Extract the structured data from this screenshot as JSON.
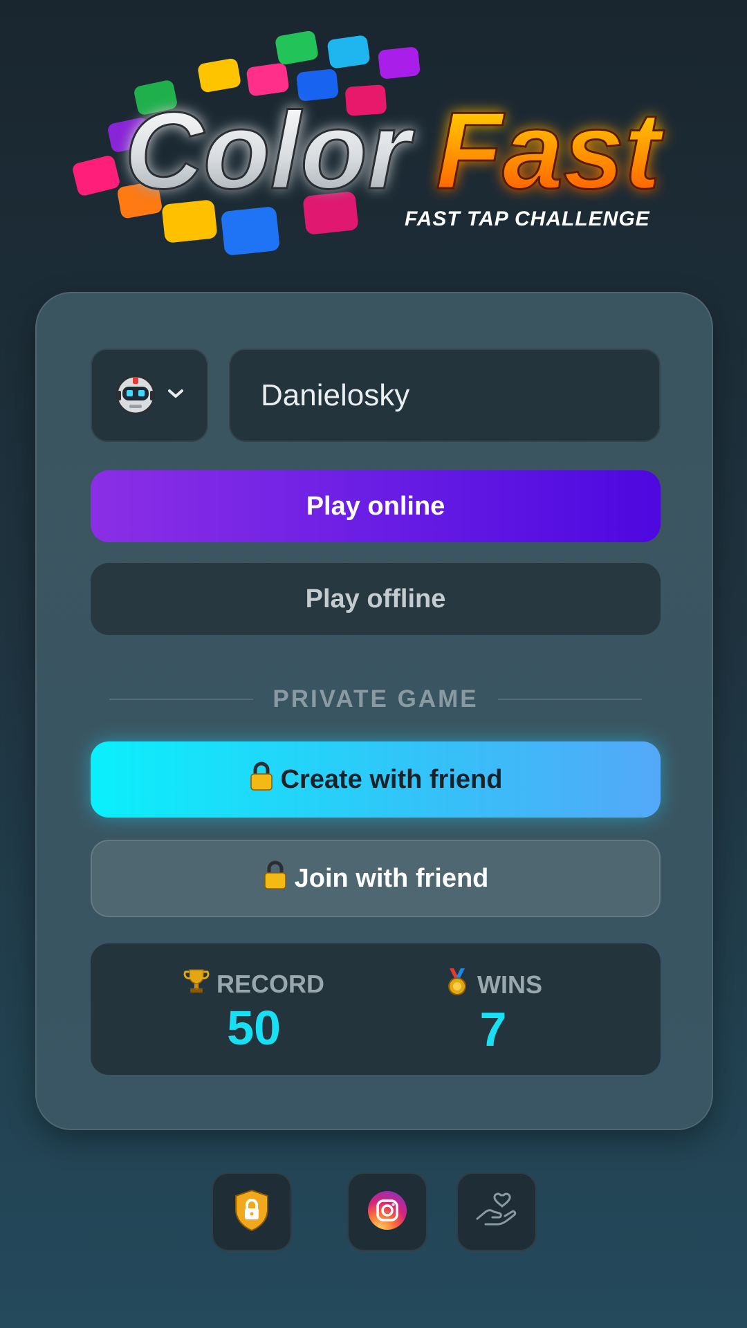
{
  "logo": {
    "word1": "Color",
    "word2": "Fast",
    "tagline": "FAST TAP CHALLENGE"
  },
  "player": {
    "avatar_icon": "robot-avatar-icon",
    "name": "Danielosky"
  },
  "buttons": {
    "play_online": "Play online",
    "play_offline": "Play offline",
    "create_with_friend": "Create with friend",
    "join_with_friend": "Join with friend"
  },
  "private_section": {
    "label": "PRIVATE GAME"
  },
  "stats": {
    "record_label": "RECORD",
    "record_value": "50",
    "wins_label": "WINS",
    "wins_value": "7"
  },
  "footer_icons": [
    "shield-lock-icon",
    "instagram-icon",
    "donate-hand-heart-icon"
  ],
  "colors": {
    "accent_cyan": "#18e0f4",
    "play_online_start": "#8b2fe6",
    "play_online_end": "#4d08e0",
    "create_start": "#0af0fb",
    "create_end": "#54a8f8"
  }
}
